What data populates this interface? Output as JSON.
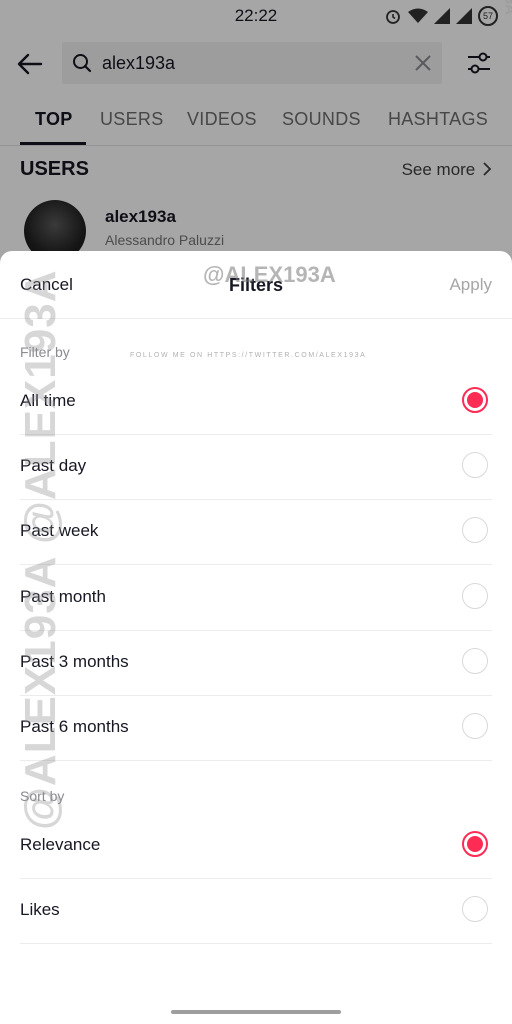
{
  "status_bar": {
    "time": "22:22",
    "battery": "57"
  },
  "search": {
    "query": "alex193a"
  },
  "tabs": [
    "TOP",
    "USERS",
    "VIDEOS",
    "SOUNDS",
    "HASHTAGS"
  ],
  "users_section": {
    "title": "USERS",
    "see_more": "See more",
    "user": {
      "username": "alex193a",
      "full_name": "Alessandro Paluzzi"
    }
  },
  "sheet": {
    "cancel": "Cancel",
    "title": "Filters",
    "apply": "Apply",
    "filter_by": {
      "label": "Filter by",
      "options": [
        {
          "label": "All time",
          "selected": true
        },
        {
          "label": "Past day",
          "selected": false
        },
        {
          "label": "Past week",
          "selected": false
        },
        {
          "label": "Past month",
          "selected": false
        },
        {
          "label": "Past 3 months",
          "selected": false
        },
        {
          "label": "Past 6 months",
          "selected": false
        }
      ]
    },
    "sort_by": {
      "label": "Sort by",
      "options": [
        {
          "label": "Relevance",
          "selected": true
        },
        {
          "label": "Likes",
          "selected": false
        }
      ]
    }
  },
  "watermarks": {
    "handle": "@ALEX193A",
    "follow": "FOLLOW ME ON HTTPS://TWITTER.COM/ALEX193A",
    "side": "@ALEX193A @ALEX193A"
  },
  "colors": {
    "accent": "#fe2c55",
    "text": "#161823",
    "muted": "#8a8b91"
  }
}
